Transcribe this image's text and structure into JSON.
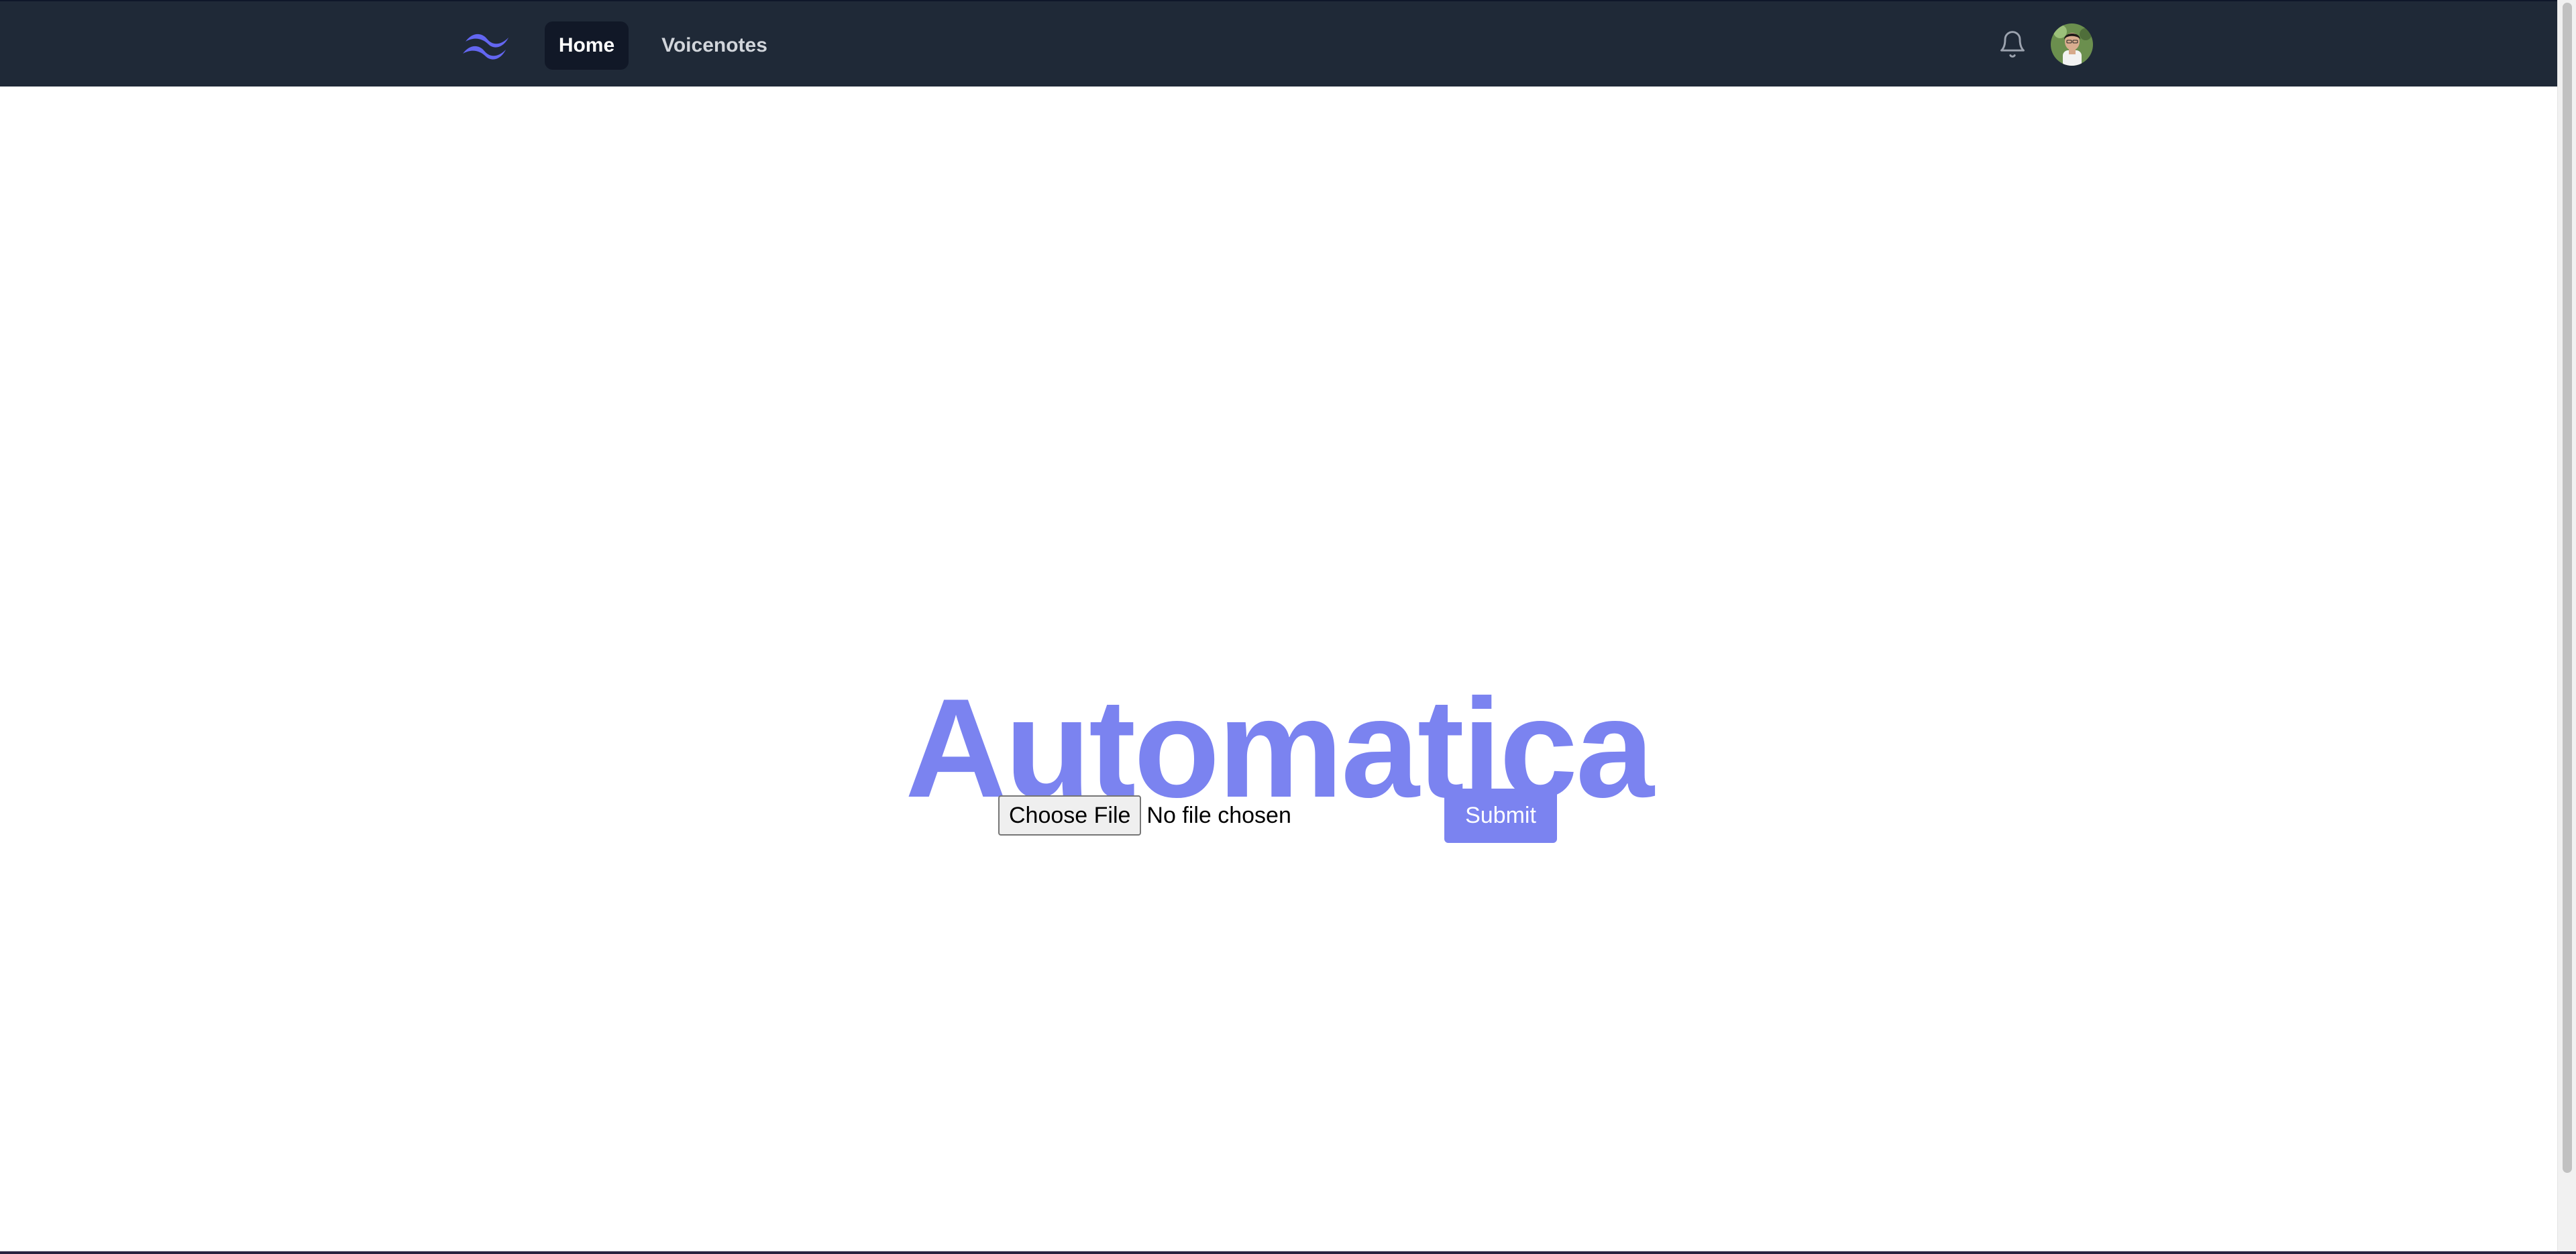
{
  "navbar": {
    "logo_icon": "tailwind-wave-logo",
    "items": [
      {
        "label": "Home",
        "active": true
      },
      {
        "label": "Voicenotes",
        "active": false
      }
    ],
    "notifications_icon": "bell-icon",
    "avatar_icon": "user-avatar"
  },
  "hero": {
    "title": "Automatica"
  },
  "upload": {
    "choose_label": "Choose File",
    "status": "No file chosen",
    "submit_label": "Submit"
  },
  "colors": {
    "navbar_bg": "#1f2937",
    "accent": "#7b83f0",
    "logo": "#6366f1"
  }
}
